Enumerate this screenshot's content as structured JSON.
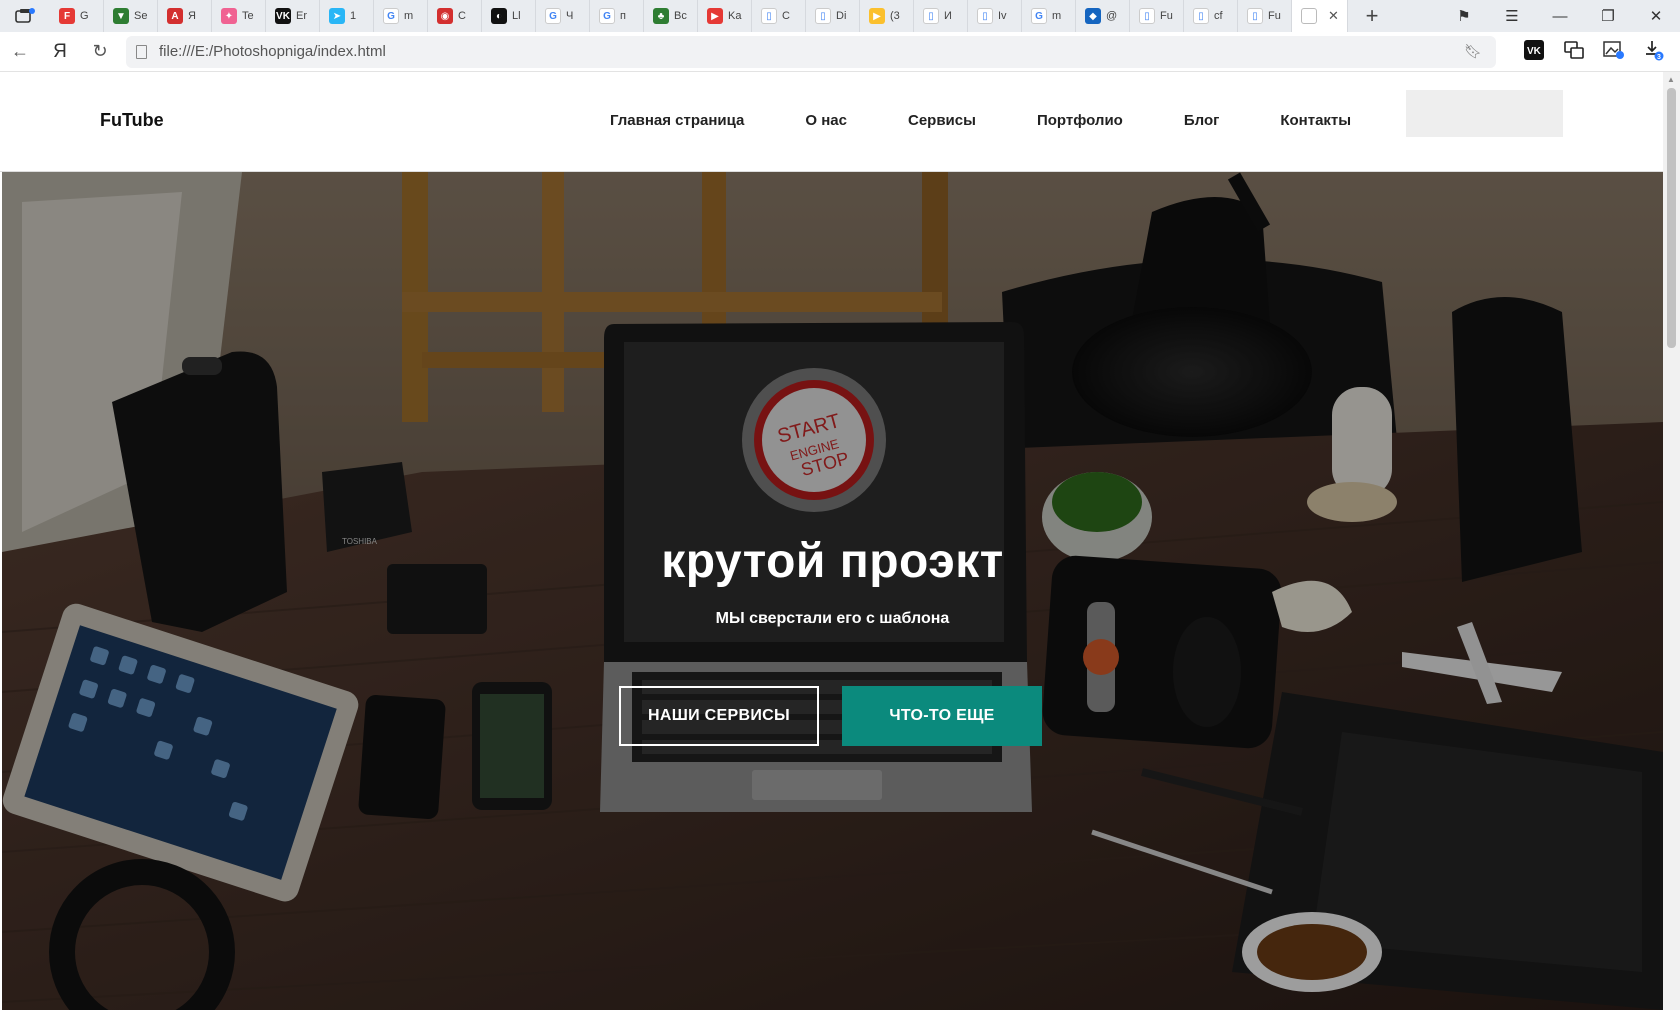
{
  "browser": {
    "tabs": [
      {
        "label": "G",
        "color": "#e53935",
        "glyph": "F"
      },
      {
        "label": "Se",
        "color": "#2e7d32",
        "glyph": "▼"
      },
      {
        "label": "Я",
        "color": "#d32f2f",
        "glyph": "A"
      },
      {
        "label": "Te",
        "color": "#f06292",
        "glyph": "✦"
      },
      {
        "label": "Er",
        "color": "#111111",
        "glyph": "VK"
      },
      {
        "label": "1",
        "color": "#29b6f6",
        "glyph": "➤"
      },
      {
        "label": "m",
        "color": "#ffffff",
        "glyph": "G"
      },
      {
        "label": "C",
        "color": "#d32f2f",
        "glyph": "◉"
      },
      {
        "label": "Ll",
        "color": "#111111",
        "glyph": "◐"
      },
      {
        "label": "Ч",
        "color": "#ffffff",
        "glyph": "G"
      },
      {
        "label": "п",
        "color": "#ffffff",
        "glyph": "G"
      },
      {
        "label": "Bc",
        "color": "#2e7d32",
        "glyph": "♣"
      },
      {
        "label": "Ka",
        "color": "#e53935",
        "glyph": "▶"
      },
      {
        "label": "C",
        "color": "#ffffff",
        "glyph": "▯"
      },
      {
        "label": "Di",
        "color": "#ffffff",
        "glyph": "▯"
      },
      {
        "label": "(3",
        "color": "#fbc02d",
        "glyph": "▶"
      },
      {
        "label": "И",
        "color": "#ffffff",
        "glyph": "▯"
      },
      {
        "label": "Iv",
        "color": "#ffffff",
        "glyph": "▯"
      },
      {
        "label": "m",
        "color": "#ffffff",
        "glyph": "G"
      },
      {
        "label": "@",
        "color": "#1565c0",
        "glyph": "◆"
      },
      {
        "label": "Fu",
        "color": "#ffffff",
        "glyph": "▯"
      },
      {
        "label": "cf",
        "color": "#ffffff",
        "glyph": "▯"
      },
      {
        "label": "Fu",
        "color": "#ffffff",
        "glyph": "▯"
      }
    ],
    "active_tab_close": "✕",
    "new_tab": "+",
    "url": "file:///E:/Photoshopniga/index.html",
    "yandex_glyph": "Я"
  },
  "site": {
    "logo": "FuTube",
    "menu": [
      "Главная страница",
      "О нас",
      "Сервисы",
      "Портфолио",
      "Блог",
      "Контакты"
    ]
  },
  "hero": {
    "title": "крутой проэкт",
    "subtitle": "МЫ сверстали его с шаблона",
    "button_primary": "НАШИ СЕРВИСЫ",
    "button_secondary": "ЧТО-ТО ЕЩЕ",
    "screen_text_1": "START",
    "screen_text_2": "ENGINE",
    "screen_text_3": "STOP",
    "speaker_brand": "TOSHIBA"
  },
  "colors": {
    "accent": "#0b8a7d"
  }
}
